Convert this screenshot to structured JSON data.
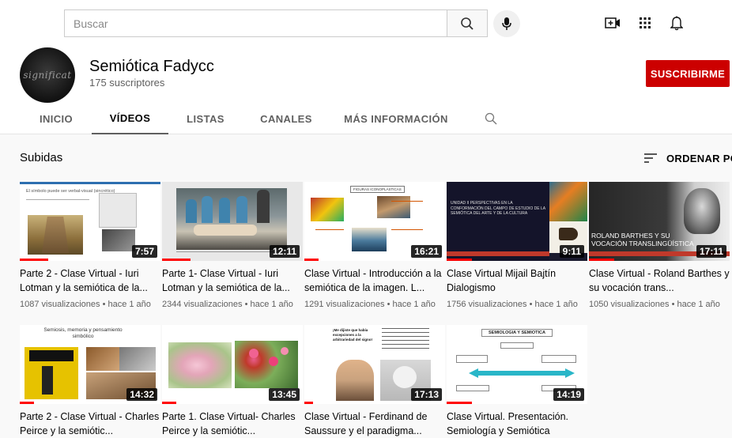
{
  "search": {
    "placeholder": "Buscar"
  },
  "icons": {
    "search": "search-icon",
    "mic": "microphone-icon",
    "create": "video-add-icon",
    "apps": "apps-grid-icon",
    "notifications": "bell-icon",
    "sort": "sort-icon"
  },
  "channel": {
    "avatar_text": "significat",
    "name": "Semiótica Fadycc",
    "subscribers": "175 suscriptores",
    "subscribe_label": "SUSCRIBIRME"
  },
  "tabs": [
    {
      "label": "INICIO"
    },
    {
      "label": "VÍDEOS"
    },
    {
      "label": "LISTAS"
    },
    {
      "label": "CANALES"
    },
    {
      "label": "MÁS INFORMACIÓN"
    }
  ],
  "section": {
    "title": "Subidas",
    "sort_label": "ORDENAR POR"
  },
  "colors": {
    "subscribe": "#cc0000",
    "progress": "#ff0000"
  },
  "videos": [
    {
      "title": "Parte 2 - Clase Virtual - Iuri Lotman y la semiótica de la...",
      "meta": "1087 visualizaciones • hace 1 año",
      "duration": "7:57",
      "watched": 0.2,
      "thumb_text": "El símbolo puede ser verbal-visual (sincrético)"
    },
    {
      "title": "Parte 1- Clase Virtual - Iuri Lotman y la semiótica de la...",
      "meta": "2344 visualizaciones • hace 1 año",
      "duration": "12:11",
      "watched": 0.2
    },
    {
      "title": "Clase Virtual - Introducción a la semiótica de la imagen. L...",
      "meta": "1291 visualizaciones • hace 1 año",
      "duration": "16:21",
      "watched": 0.1,
      "thumb_text": "FIGURAS ICONOPLÁSTICAS"
    },
    {
      "title": "Clase Virtual Mijail Bajtín Dialogismo",
      "meta": "1756 visualizaciones • hace 1 año",
      "duration": "9:11",
      "watched": 0.18,
      "thumb_text": "UNIDAD II PERSPECTIVAS EN LA CONFORMACIÓN DEL CAMPO DE ESTUDIO DE LA SEMIÓTICA DEL ARTE Y DE LA CULTURA"
    },
    {
      "title": "Clase Virtual - Roland Barthes y su vocación trans...",
      "meta": "1050 visualizaciones • hace 1 año",
      "duration": "17:11",
      "watched": 0.18,
      "thumb_text": "ROLAND BARTHES Y SU VOCACIÓN TRANSLINGÜÍSTICA"
    },
    {
      "title": "Parte 2 - Clase Virtual - Charles Peirce y la semiótic...",
      "meta": "",
      "duration": "14:32",
      "watched": 0.1,
      "thumb_text": "Semiosis, memoria y pensamiento simbólico"
    },
    {
      "title": "Parte 1. Clase Virtual- Charles Peirce y la semiótic...",
      "meta": "",
      "duration": "13:45",
      "watched": 0.1
    },
    {
      "title": "Clase Virtual - Ferdinand de Saussure y el paradigma...",
      "meta": "",
      "duration": "17:13",
      "watched": 0.06,
      "thumb_text": "¡Me dijiste que había excepciones a la arbitrariedad del signo!"
    },
    {
      "title": "Clase Virtual. Presentación. Semiología y Semiótica",
      "meta": "",
      "duration": "14:19",
      "watched": 0.18,
      "thumb_text": "SEMIOLOGIA Y SEMIOTICA"
    }
  ]
}
